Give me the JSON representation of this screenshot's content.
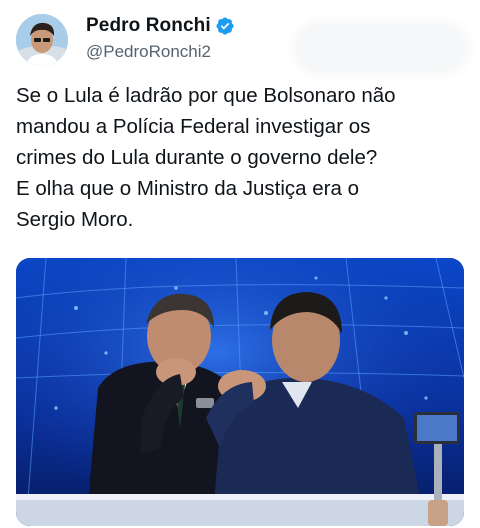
{
  "author": {
    "display_name": "Pedro Ronchi",
    "handle": "@PedroRonchi2",
    "verified": true
  },
  "tweet": {
    "lines": [
      "Se o Lula é ladrão por que Bolsonaro não",
      "mandou a Polícia Federal investigar os",
      "crimes do Lula durante o governo dele?",
      "E olha que o Ministro da Justiça era o",
      "Sergio Moro."
    ]
  },
  "media": {
    "description_icon": "photo-icon"
  },
  "colors": {
    "verified_blue": "#1d9bf0",
    "handle_gray": "#536471",
    "text": "#0f1419",
    "studio_blue": "#0a3fb5"
  }
}
